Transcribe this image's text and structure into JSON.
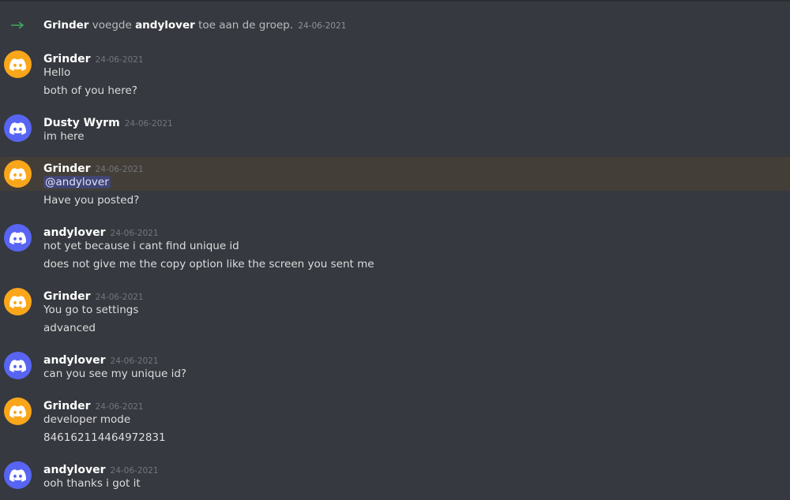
{
  "colors": {
    "background": "#36393f",
    "avatar_orange": "#faa61a",
    "avatar_blurple": "#5865f2",
    "mention_highlight": "#433e37",
    "mention_pill": "#414675",
    "join_arrow": "#3ba55d"
  },
  "system_message": {
    "icon": "join-arrow-icon",
    "actor": "Grinder",
    "verb": "voegde",
    "target": "andylover",
    "suffix": "toe aan de groep.",
    "timestamp": "24-06-2021"
  },
  "messages": [
    {
      "author": "Grinder",
      "timestamp": "24-06-2021",
      "avatar_color": "orange",
      "lines": [
        "Hello",
        "both of you here?"
      ]
    },
    {
      "author": "Dusty Wyrm",
      "timestamp": "24-06-2021",
      "avatar_color": "blurple",
      "lines": [
        "im here"
      ]
    },
    {
      "author": "Grinder",
      "timestamp": "24-06-2021",
      "avatar_color": "orange",
      "highlighted": true,
      "mention": "@andylover",
      "lines": [
        "Have you posted?"
      ]
    },
    {
      "author": "andylover",
      "timestamp": "24-06-2021",
      "avatar_color": "blurple",
      "lines": [
        "not yet because i cant find unique id",
        "does not give me the copy option like the screen you sent me"
      ]
    },
    {
      "author": "Grinder",
      "timestamp": "24-06-2021",
      "avatar_color": "orange",
      "lines": [
        "You go to settings",
        "advanced"
      ]
    },
    {
      "author": "andylover",
      "timestamp": "24-06-2021",
      "avatar_color": "blurple",
      "lines": [
        "can you see my unique id?"
      ]
    },
    {
      "author": "Grinder",
      "timestamp": "24-06-2021",
      "avatar_color": "orange",
      "lines": [
        "developer mode",
        "846162114464972831"
      ]
    },
    {
      "author": "andylover",
      "timestamp": "24-06-2021",
      "avatar_color": "blurple",
      "lines": [
        "ooh thanks i got it"
      ]
    }
  ]
}
